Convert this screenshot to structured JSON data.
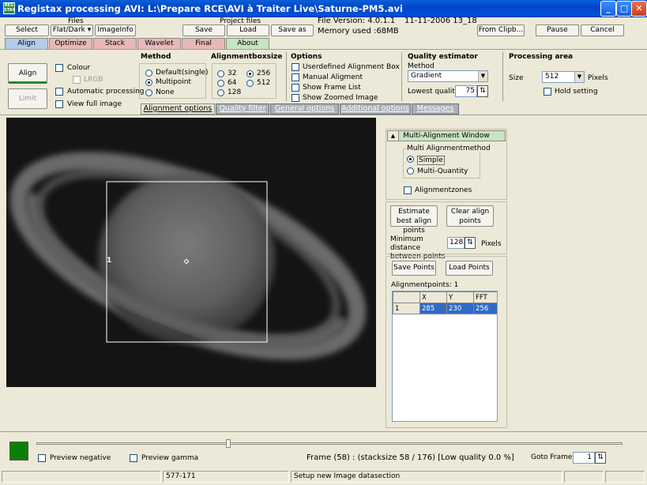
{
  "title": "Registax processing AVI: L:\\Prepare RCE\\AVI à Traiter Live\\Saturne-PM5.avi",
  "top": {
    "files_header": "Files",
    "project_header": "Project files",
    "select": "Select",
    "flatdark": "Flat/Dark ▾",
    "imageinfo": "ImageInfo",
    "save": "Save",
    "load": "Load",
    "saveas": "Save as",
    "version": "File Version: 4.0.1.1",
    "date": "11-11-2006 13_18",
    "memory": "Memory used :68MB",
    "fromclip": "From Clipb...",
    "pause": "Pause",
    "cancel": "Cancel"
  },
  "tabs": [
    "Align",
    "Optimize",
    "Stack",
    "Wavelet",
    "Final",
    "About"
  ],
  "left": {
    "align": "Align",
    "limit": "Limit",
    "colour": "Colour",
    "lrgb": "LRGB",
    "auto": "Automatic processing",
    "viewfull": "View full image"
  },
  "method": {
    "title": "Method",
    "opt1": "Default(single)",
    "opt2": "Multipoint",
    "opt3": "None"
  },
  "abs": {
    "title": "Alignmentboxsize",
    "v32": "32",
    "v64": "64",
    "v128": "128",
    "v256": "256",
    "v512": "512"
  },
  "options": {
    "title": "Options",
    "o1": "Userdefined Alignment Box",
    "o2": "Manual Aligment",
    "o3": "Show Frame List",
    "o4": "Show Zoomed Image"
  },
  "quality": {
    "title": "Quality estimator",
    "method_label": "Method",
    "method_value": "Gradient",
    "lowest_label": "Lowest quality",
    "lowest_value": "75"
  },
  "processing": {
    "title": "Processing area",
    "size_label": "Size",
    "size_value": "512",
    "pixels": "Pixels",
    "hold": "Hold setting"
  },
  "subtabs": [
    "Alignment options",
    "Quality filter",
    "General options",
    "Additional options",
    "Messages"
  ],
  "image": {
    "point_label": "1"
  },
  "multi": {
    "header": "Multi-Alignment Window",
    "method_title": "Multi Alignmentmethod",
    "simple": "Simple",
    "multiq": "Multi-Quantity",
    "zones": "Alignmentzones",
    "estimate": "Estimate best align points",
    "clear": "Clear align points",
    "mindist_label": "Minimum distance between points",
    "mindist_value": "128",
    "pixels": "Pixels",
    "savepoints": "Save Points",
    "loadpoints": "Load Points",
    "ap_count": "Alignmentpoints: 1",
    "cols": [
      "X",
      "Y",
      "FFT"
    ],
    "rows": [
      {
        "id": "1",
        "x": "285",
        "y": "230",
        "fft": "256"
      }
    ]
  },
  "bottom": {
    "preview_neg": "Preview negative",
    "preview_gamma": "Preview gamma",
    "frame_text": "Frame (58) :  (stacksize 58 / 176) [Low quality 0.0 %]",
    "goto": "Goto Frame",
    "goto_value": "1",
    "status1": "577-171",
    "status2": "Setup new Image datasection"
  }
}
